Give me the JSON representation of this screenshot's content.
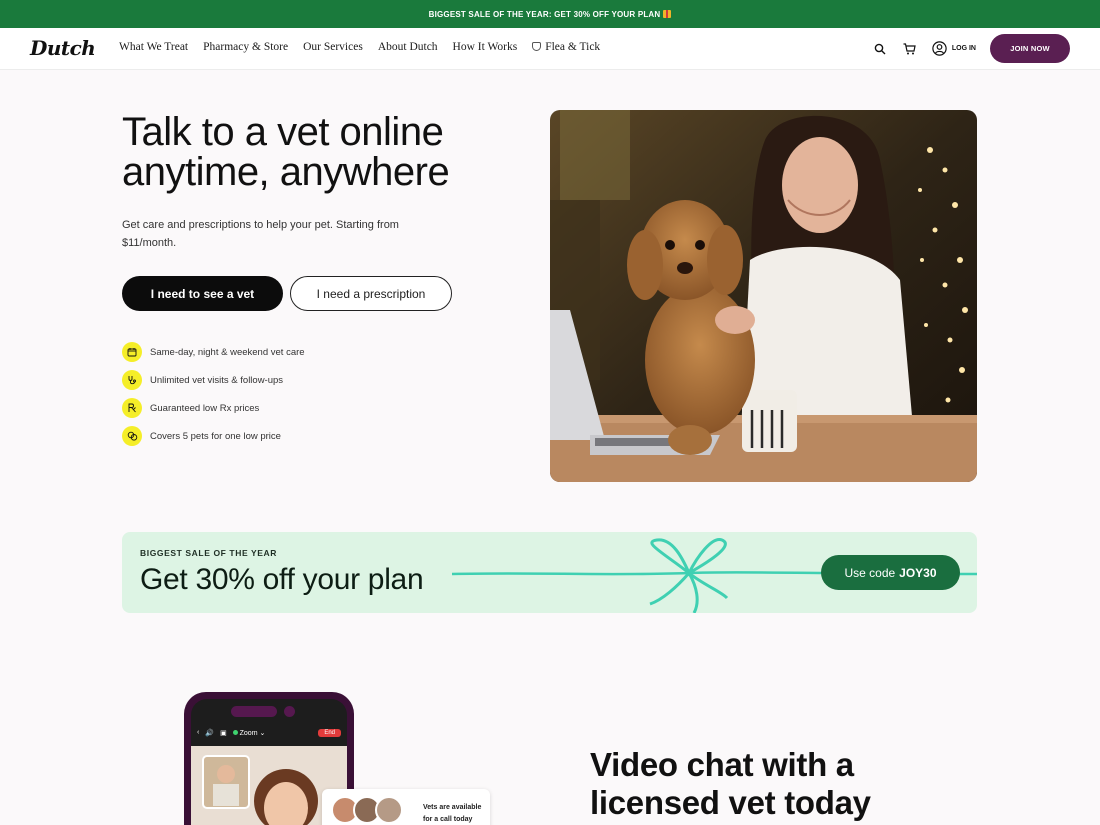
{
  "promo": {
    "text": "BIGGEST SALE OF THE YEAR: GET 30% OFF YOUR PLAN",
    "icon": "gift-icon"
  },
  "nav": {
    "logo": "Dutch",
    "links": [
      "What We Treat",
      "Pharmacy & Store",
      "Our Services",
      "About Dutch",
      "How It Works",
      "Flea & Tick"
    ],
    "login_label": "LOG IN",
    "join_label": "JOIN NOW"
  },
  "hero": {
    "title": "Talk to a vet online anytime, anywhere",
    "subtitle": "Get care and prescriptions to help your pet. Starting from $11/month.",
    "primary_cta": "I need to see a vet",
    "secondary_cta": "I need a prescription",
    "features": [
      {
        "icon": "calendar-icon",
        "text": "Same-day, night & weekend vet care"
      },
      {
        "icon": "stethoscope-icon",
        "text": "Unlimited vet visits & follow-ups"
      },
      {
        "icon": "rx-icon",
        "text": "Guaranteed low Rx prices"
      },
      {
        "icon": "pets-icon",
        "text": "Covers 5 pets for one low price"
      }
    ]
  },
  "sale": {
    "kicker": "BIGGEST SALE OF THE YEAR",
    "title": "Get 30% off your plan",
    "code_prefix": "Use code",
    "code": "JOY30"
  },
  "video": {
    "phone_app": "Zoom",
    "end_label": "End",
    "availability": "Vets are available for a call today",
    "title": "Video chat with a licensed vet today"
  },
  "colors": {
    "promo_green": "#1a7a3c",
    "join_purple": "#5a1f52",
    "feature_yellow": "#f5ee28",
    "sale_bg": "#ddf4e4",
    "code_green": "#1a6e3f",
    "ribbon": "#3fd0b2"
  }
}
